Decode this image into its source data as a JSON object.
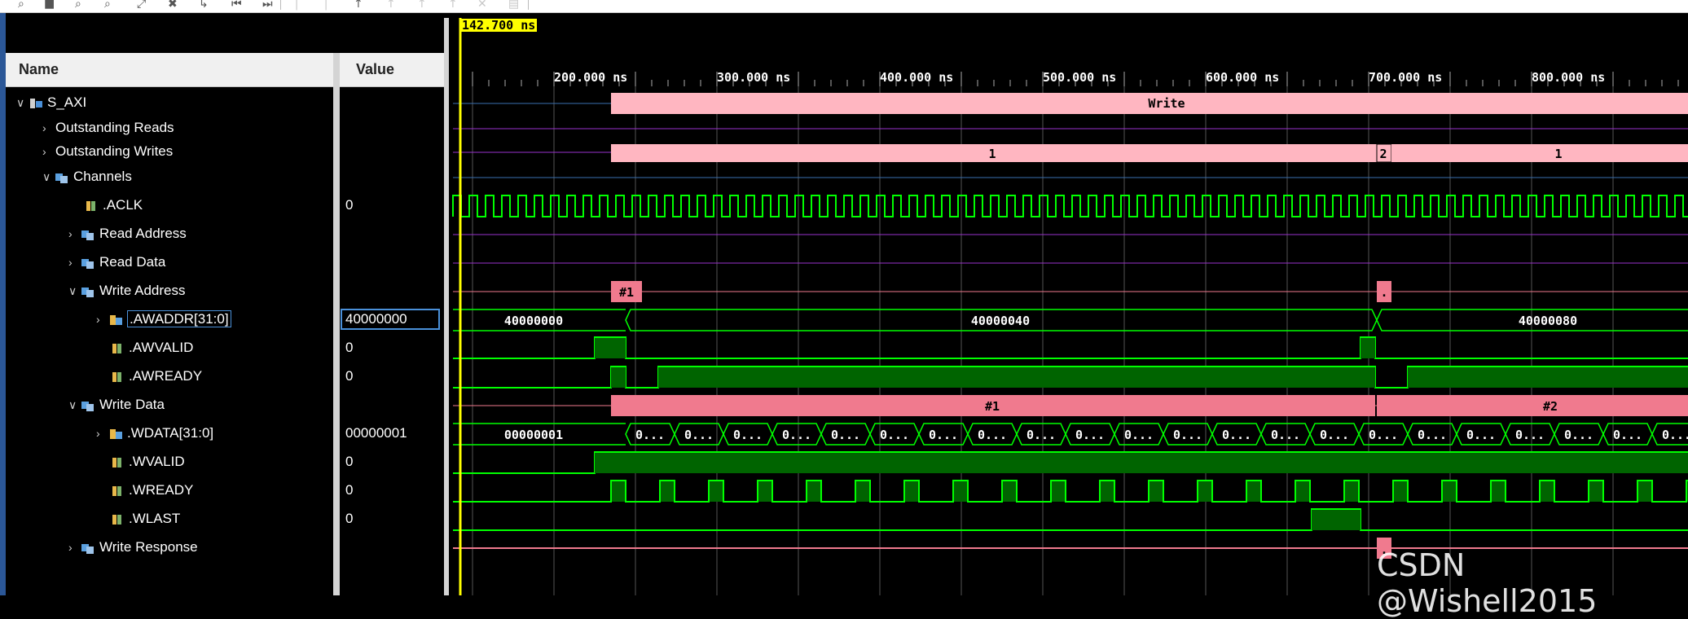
{
  "toolbar": {
    "icons": [
      "search-icon",
      "save-icon",
      "zoom-in-icon",
      "zoom-out-icon",
      "zoom-fit-icon",
      "cursor-icon",
      "add-marker-icon",
      "go-first-icon",
      "go-next-icon",
      "swap-icon",
      "swap2-icon",
      "step-icon",
      "step2-icon",
      "marker-icon",
      "close-marker-icon",
      "snap-icon"
    ]
  },
  "header": {
    "name_col": "Name",
    "value_col": "Value"
  },
  "cursor": {
    "time_label": "142.700 ns"
  },
  "ruler": {
    "labels": [
      "200.000 ns",
      "300.000 ns",
      "400.000 ns",
      "500.000 ns",
      "600.000 ns",
      "700.000 ns",
      "800.000 ns"
    ]
  },
  "tree": {
    "rows": [
      {
        "label": "S_AXI",
        "value": ""
      },
      {
        "label": "Outstanding Reads",
        "value": ""
      },
      {
        "label": "Outstanding Writes",
        "value": ""
      },
      {
        "label": "Channels",
        "value": ""
      },
      {
        "label": ".ACLK",
        "value": "0"
      },
      {
        "label": "Read Address",
        "value": ""
      },
      {
        "label": "Read Data",
        "value": ""
      },
      {
        "label": "Write Address",
        "value": ""
      },
      {
        "label": ".AWADDR[31:0]",
        "value": "40000000"
      },
      {
        "label": ".AWVALID",
        "value": "0"
      },
      {
        "label": ".AWREADY",
        "value": "0"
      },
      {
        "label": "Write Data",
        "value": ""
      },
      {
        "label": ".WDATA[31:0]",
        "value": "00000001"
      },
      {
        "label": ".WVALID",
        "value": "0"
      },
      {
        "label": ".WREADY",
        "value": "0"
      },
      {
        "label": ".WLAST",
        "value": "0"
      },
      {
        "label": "Write Response",
        "value": ""
      }
    ]
  },
  "waves": {
    "s_axi_label": "Write",
    "outstanding_writes": [
      "1",
      "2",
      "1"
    ],
    "aw_transaction": "#1",
    "aw_transaction2": ".",
    "awaddr_values": [
      "40000000",
      "40000040",
      "40000080"
    ],
    "w_transactions": [
      "#1",
      "#2"
    ],
    "wdata_first": "00000001",
    "wdata_elided": "0...",
    "b_marker": "."
  },
  "colors": {
    "wave_green": "#00ff00",
    "wave_fill": "#006400",
    "pink": "#ffb6c1",
    "hot_pink": "#f07a8e",
    "cursor_yellow": "#ffff00",
    "grid": "#555555",
    "purple": "#9932cc"
  },
  "watermark": "CSDN @Wishell2015"
}
